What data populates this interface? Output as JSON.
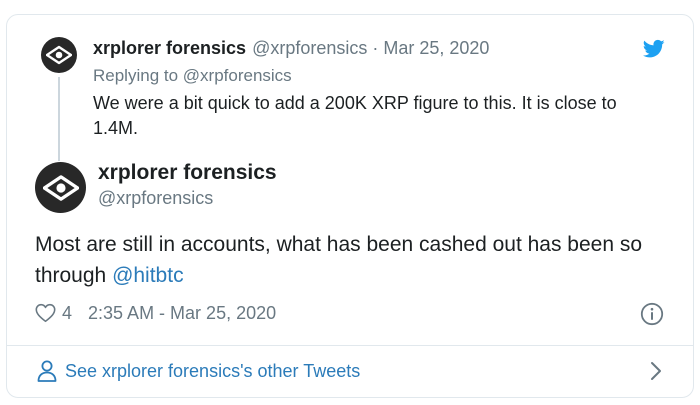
{
  "parent_tweet": {
    "author_name": "xrplorer forensics",
    "handle": "@xrpforensics",
    "separator": "·",
    "date": "Mar 25, 2020",
    "replying_to": "Replying to @xrpforensics",
    "text": "We were a bit quick to add a 200K XRP figure to this. It is close to 1.4M."
  },
  "main_tweet": {
    "author_name": "xrplorer forensics",
    "handle": "@xrpforensics",
    "text_before_mention": "Most are still in accounts, what has been cashed out has been so through ",
    "mention": "@hitbtc",
    "like_count": "4",
    "timestamp": "2:35 AM - Mar 25, 2020"
  },
  "footer": {
    "link_text": "See xrplorer forensics's other Tweets"
  },
  "icons": {
    "logo": "twitter-bird-icon",
    "like": "heart-icon",
    "info": "info-icon",
    "profile": "person-icon",
    "more": "chevron-right-icon",
    "avatar": "eye-logo-icon"
  },
  "colors": {
    "brand": "#1da1f2",
    "link": "#2b7bb9",
    "muted": "#697882",
    "border": "#e1e8ed"
  }
}
